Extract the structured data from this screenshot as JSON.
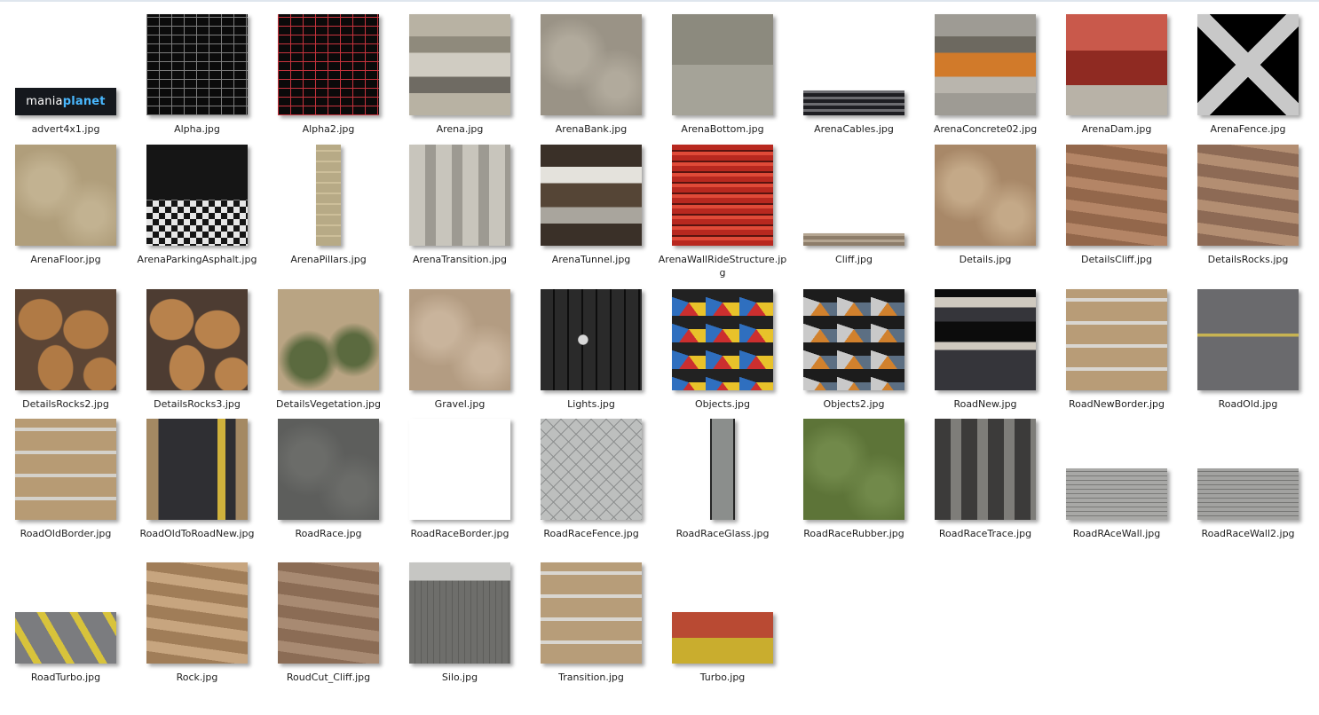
{
  "files": [
    {
      "name": "advert4x1.jpg",
      "pattern": "logo",
      "logo": {
        "part1": "mania",
        "part2": "planet"
      },
      "colors": [
        "#15181d",
        "#2a2f36"
      ]
    },
    {
      "name": "Alpha.jpg",
      "pattern": "structure",
      "colors": [
        "#0b0b0b",
        "#7d7d7d"
      ]
    },
    {
      "name": "Alpha2.jpg",
      "pattern": "structure",
      "colors": [
        "#0a0a0a",
        "#c7333d"
      ]
    },
    {
      "name": "Arena.jpg",
      "pattern": "hstripes",
      "colors": [
        "#b8b2a3",
        "#8f8a7c",
        "#d0ccc2",
        "#6f6b63"
      ]
    },
    {
      "name": "ArenaBank.jpg",
      "pattern": "solid",
      "colors": [
        "#9a9386",
        "#b1aa9c"
      ]
    },
    {
      "name": "ArenaBottom.jpg",
      "pattern": "split",
      "colors": [
        "#8c8a7e",
        "#a5a398"
      ]
    },
    {
      "name": "ArenaCables.jpg",
      "pattern": "strip",
      "colors": [
        "#1e1e22",
        "#6c6c70"
      ]
    },
    {
      "name": "ArenaConcrete02.jpg",
      "pattern": "hstripes",
      "colors": [
        "#9e9b94",
        "#6d6960",
        "#d17a2a",
        "#b9b5ad"
      ]
    },
    {
      "name": "ArenaDam.jpg",
      "pattern": "dam",
      "colors": [
        "#c9594b",
        "#8f2a22",
        "#b8b2a7"
      ]
    },
    {
      "name": "ArenaFence.jpg",
      "pattern": "fence",
      "colors": [
        "#000000",
        "#c8c8c8"
      ]
    },
    {
      "name": "ArenaFloor.jpg",
      "pattern": "solid",
      "colors": [
        "#b09e7b",
        "#c2b291"
      ]
    },
    {
      "name": "ArenaParkingAsphalt.jpg",
      "pattern": "parking",
      "colors": [
        "#151515",
        "#e6e6e6",
        "#d4b52c"
      ]
    },
    {
      "name": "ArenaPillars.jpg",
      "pattern": "pillar",
      "colors": [
        "#b7aa86",
        "#cdbf9a"
      ]
    },
    {
      "name": "ArenaTransition.jpg",
      "pattern": "vstripes",
      "colors": [
        "#c8c5bc",
        "#9d9a92"
      ]
    },
    {
      "name": "ArenaTunnel.jpg",
      "pattern": "hstripes",
      "colors": [
        "#3a3028",
        "#e4e2dc",
        "#554536",
        "#a9a59d"
      ]
    },
    {
      "name": "ArenaWallRideStructure.jpg",
      "pattern": "redribs",
      "colors": [
        "#b8281f",
        "#e04a38"
      ]
    },
    {
      "name": "Cliff.jpg",
      "pattern": "strip",
      "colors": [
        "#8d7d6a",
        "#b4a591"
      ]
    },
    {
      "name": "Details.jpg",
      "pattern": "solid",
      "colors": [
        "#a88868",
        "#c4a988"
      ]
    },
    {
      "name": "DetailsCliff.jpg",
      "pattern": "rockbands",
      "colors": [
        "#93674b",
        "#b48566"
      ]
    },
    {
      "name": "DetailsRocks.jpg",
      "pattern": "rockbands",
      "colors": [
        "#8d6a55",
        "#b38e72"
      ]
    },
    {
      "name": "DetailsRocks2.jpg",
      "pattern": "rocks",
      "colors": [
        "#5c4535",
        "#b07a45"
      ]
    },
    {
      "name": "DetailsRocks3.jpg",
      "pattern": "rocks",
      "colors": [
        "#4d3c32",
        "#b8824c"
      ]
    },
    {
      "name": "DetailsVegetation.jpg",
      "pattern": "vegetation",
      "colors": [
        "#b9a483",
        "#5b6a3f"
      ]
    },
    {
      "name": "Gravel.jpg",
      "pattern": "solid",
      "colors": [
        "#b39c82",
        "#c9b49c"
      ]
    },
    {
      "name": "Lights.jpg",
      "pattern": "lights",
      "colors": [
        "#0d0d0d",
        "#d8d8d8"
      ]
    },
    {
      "name": "Objects.jpg",
      "pattern": "objects",
      "colors": [
        "#222222",
        "#e8c22a",
        "#cc2f2f",
        "#2f6fbf"
      ]
    },
    {
      "name": "Objects2.jpg",
      "pattern": "objects",
      "colors": [
        "#1c1c1c",
        "#5c6f83",
        "#d1812d",
        "#c9c9c9"
      ]
    },
    {
      "name": "RoadNew.jpg",
      "pattern": "road",
      "colors": [
        "#35353a",
        "#cfc9bf",
        "#0c0c0c"
      ]
    },
    {
      "name": "RoadNewBorder.jpg",
      "pattern": "borderroad",
      "colors": [
        "#b89c77",
        "#d9d6d1"
      ]
    },
    {
      "name": "RoadOld.jpg",
      "pattern": "roadold",
      "colors": [
        "#6a6a6d",
        "#c7b352"
      ]
    },
    {
      "name": "RoadOldBorder.jpg",
      "pattern": "borderroad",
      "colors": [
        "#b79b74",
        "#d4d1ca"
      ]
    },
    {
      "name": "RoadOldToRoadNew.jpg",
      "pattern": "transitionroad",
      "colors": [
        "#2f2f33",
        "#d0b23c",
        "#a48963"
      ]
    },
    {
      "name": "RoadRace.jpg",
      "pattern": "solid",
      "colors": [
        "#5d5e5c",
        "#6b6c69"
      ]
    },
    {
      "name": "RoadRaceBorder.jpg",
      "pattern": "raceborder",
      "colors": [
        "#b99d78",
        "#bb2f2f",
        "#eeeeee"
      ]
    },
    {
      "name": "RoadRaceFence.jpg",
      "pattern": "mesh",
      "colors": [
        "#bdbfbe",
        "#8e9190"
      ]
    },
    {
      "name": "RoadRaceGlass.jpg",
      "pattern": "glass",
      "colors": [
        "#8b8e8c",
        "#262626"
      ]
    },
    {
      "name": "RoadRaceRubber.jpg",
      "pattern": "solid",
      "colors": [
        "#5d7438",
        "#71894a"
      ]
    },
    {
      "name": "RoadRaceTrace.jpg",
      "pattern": "vstripes",
      "colors": [
        "#3c3b3a",
        "#7e7d79"
      ]
    },
    {
      "name": "RoadRAceWall.jpg",
      "pattern": "wall",
      "colors": [
        "#a8a8a6",
        "#7a7a78"
      ]
    },
    {
      "name": "RoadRaceWall2.jpg",
      "pattern": "wall",
      "colors": [
        "#a2a2a0",
        "#767674"
      ]
    },
    {
      "name": "RoadTurbo.jpg",
      "pattern": "turbo",
      "colors": [
        "#7b7c7f",
        "#d8c33b"
      ]
    },
    {
      "name": "Rock.jpg",
      "pattern": "rockbands",
      "colors": [
        "#a07d58",
        "#c7a57f"
      ]
    },
    {
      "name": "RoudCut_Cliff.jpg",
      "pattern": "rockbands",
      "colors": [
        "#8b6c55",
        "#a88a72"
      ]
    },
    {
      "name": "Silo.jpg",
      "pattern": "silo",
      "colors": [
        "#c6c6c3",
        "#6e6e6b",
        "#8a5a2e"
      ]
    },
    {
      "name": "Transition.jpg",
      "pattern": "borderroad",
      "colors": [
        "#b79d79",
        "#d9d6d0"
      ]
    },
    {
      "name": "Turbo.jpg",
      "pattern": "chevrons",
      "colors": [
        "#b94a33",
        "#c9ad2e"
      ]
    }
  ]
}
